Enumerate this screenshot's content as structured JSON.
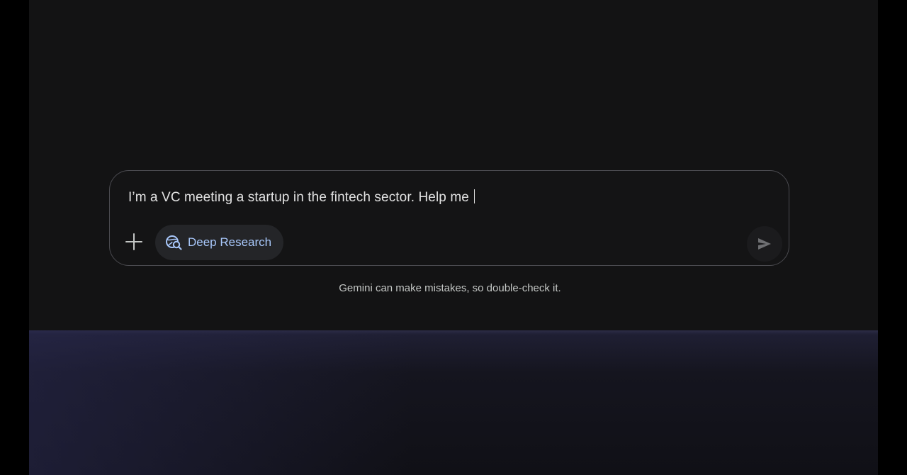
{
  "prompt": {
    "text": "I’m a VC meeting a startup in the fintech sector. Help me "
  },
  "toolbar": {
    "add_icon": "plus-icon",
    "deep_research_label": "Deep Research",
    "deep_research_icon": "globe-search-icon",
    "send_icon": "send-arrow-icon"
  },
  "footer": {
    "disclaimer": "Gemini can make mistakes, so double-check it."
  },
  "colors": {
    "background": "#131314",
    "text": "#e3e3e3",
    "accent": "#a8c7fa",
    "chip_background": "#242528"
  }
}
